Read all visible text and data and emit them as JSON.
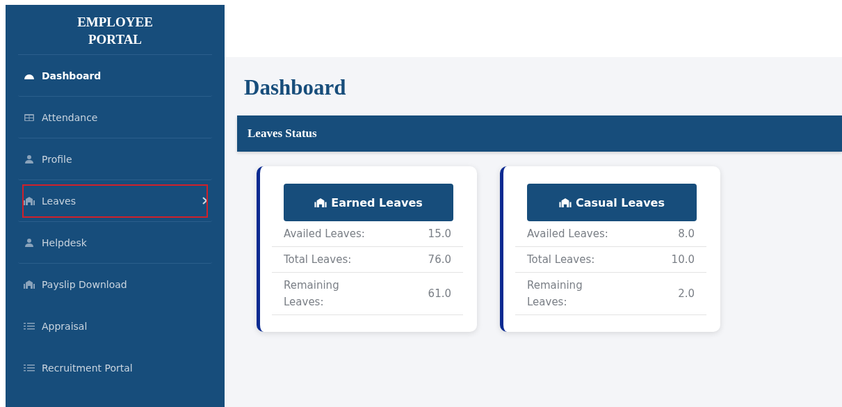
{
  "sidebar": {
    "title": "EMPLOYEE PORTAL",
    "items": [
      {
        "label": "Dashboard",
        "selected": true,
        "divider": true,
        "submenu": false,
        "highlighted": false
      },
      {
        "label": "Attendance",
        "selected": false,
        "divider": true,
        "submenu": false,
        "highlighted": false
      },
      {
        "label": "Profile",
        "selected": false,
        "divider": true,
        "submenu": false,
        "highlighted": false
      },
      {
        "label": "Leaves",
        "selected": false,
        "divider": true,
        "submenu": true,
        "highlighted": true
      },
      {
        "label": "Helpdesk",
        "selected": false,
        "divider": true,
        "submenu": false,
        "highlighted": false
      },
      {
        "label": "Payslip Download",
        "selected": false,
        "divider": false,
        "submenu": false,
        "highlighted": false
      },
      {
        "label": "Appraisal",
        "selected": false,
        "divider": false,
        "submenu": false,
        "highlighted": false
      },
      {
        "label": "Recruitment Portal",
        "selected": false,
        "divider": false,
        "submenu": false,
        "highlighted": false
      }
    ]
  },
  "page_title": "Dashboard",
  "section": {
    "title": "Leaves Status",
    "cards": [
      {
        "title": "Earned Leaves",
        "rows": [
          {
            "label": "Availed Leaves:",
            "value": "15.0"
          },
          {
            "label": "Total Leaves:",
            "value": "76.0"
          },
          {
            "label": "Remaining Leaves:",
            "value": "61.0"
          }
        ]
      },
      {
        "title": "Casual Leaves",
        "rows": [
          {
            "label": "Availed Leaves:",
            "value": "8.0"
          },
          {
            "label": "Total Leaves:",
            "value": "10.0"
          },
          {
            "label": "Remaining Leaves:",
            "value": "2.0"
          }
        ]
      }
    ]
  }
}
